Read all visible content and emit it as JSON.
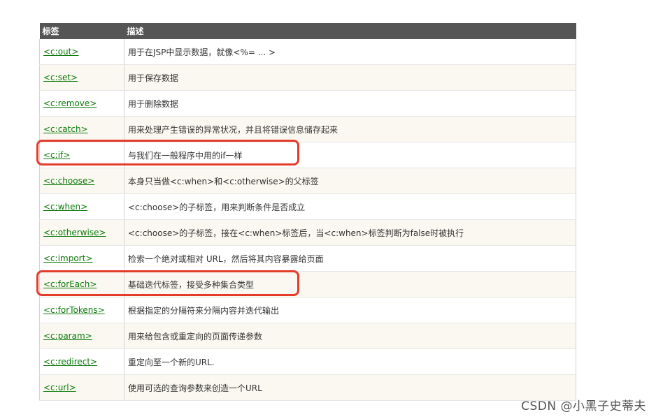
{
  "table": {
    "headers": [
      "标签",
      "描述"
    ],
    "rows": [
      {
        "tag": "<c:out>",
        "desc": "用于在JSP中显示数据，就像<%= ... >"
      },
      {
        "tag": "<c:set>",
        "desc": "用于保存数据"
      },
      {
        "tag": "<c:remove>",
        "desc": "用于删除数据"
      },
      {
        "tag": "<c:catch>",
        "desc": "用来处理产生错误的异常状况，并且将错误信息储存起来"
      },
      {
        "tag": "<c:if>",
        "desc": "与我们在一般程序中用的if一样"
      },
      {
        "tag": "<c:choose>",
        "desc": "本身只当做<c:when>和<c:otherwise>的父标签"
      },
      {
        "tag": "<c:when>",
        "desc": "<c:choose>的子标签，用来判断条件是否成立"
      },
      {
        "tag": "<c:otherwise>",
        "desc": "<c:choose>的子标签，接在<c:when>标签后，当<c:when>标签判断为false时被执行"
      },
      {
        "tag": "<c:import>",
        "desc": "检索一个绝对或相对 URL，然后将其内容暴露给页面"
      },
      {
        "tag": "<c:forEach>",
        "desc": "基础迭代标签，接受多种集合类型"
      },
      {
        "tag": "<c:forTokens>",
        "desc": "根据指定的分隔符来分隔内容并迭代输出"
      },
      {
        "tag": "<c:param>",
        "desc": "用来给包含或重定向的页面传递参数"
      },
      {
        "tag": "<c:redirect>",
        "desc": "重定向至一个新的URL."
      },
      {
        "tag": "<c:url>",
        "desc": "使用可选的查询参数来创造一个URL"
      }
    ]
  },
  "watermark": "CSDN @小黑子史蒂夫",
  "colors": {
    "header_bg": "#555555",
    "link": "#0b7a0b",
    "highlight": "#e43b2b",
    "alt_row": "#fbf8f1"
  }
}
